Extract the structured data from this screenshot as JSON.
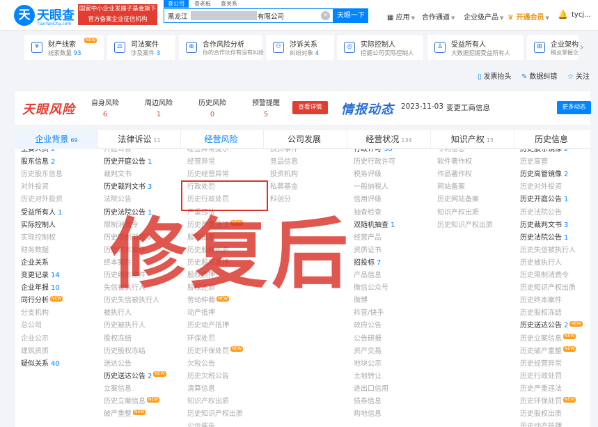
{
  "header": {
    "logo_mark": "天",
    "logo_name": "天眼查",
    "logo_domain": "TianYanCha.com",
    "slogan_line1": "国家中小企业发展子基金旗下",
    "slogan_line2": "官方备案企业征信机构",
    "search_tabs": [
      "查公司",
      "查老板",
      "查关系"
    ],
    "search_value_prefix": "黑龙江",
    "search_value_suffix": "有限公司",
    "search_button": "天眼一下",
    "nav": [
      {
        "label": "应用",
        "icon": "grid-icon"
      },
      {
        "label": "合作通道"
      },
      {
        "label": "企业级产品"
      },
      {
        "label": "开通会员",
        "icon": "crown-icon"
      }
    ],
    "user": "tycj..."
  },
  "cards": [
    {
      "title": "财产线索",
      "sub_prefix": "线索数量",
      "sub_value": "93",
      "badge": "NEW",
      "icon": "money-icon"
    },
    {
      "title": "司法案件",
      "sub_prefix": "涉及案件",
      "sub_value": "3",
      "icon": "gavel-icon"
    },
    {
      "title": "合作风险分析",
      "sub_prefix": "你的合作伙伴有没有纠纷",
      "sub_value": "",
      "icon": "handshake-icon"
    },
    {
      "title": "涉诉关系",
      "sub_prefix": "纠纷对象",
      "sub_value": "4",
      "icon": "people-icon"
    },
    {
      "title": "实际控制人",
      "sub_prefix": "挖掘公司实际控制人",
      "sub_value": "",
      "icon": "target-icon"
    },
    {
      "title": "受益所有人",
      "sub_prefix": "大数据挖掘受益所有人",
      "sub_value": "",
      "icon": "person-icon"
    },
    {
      "title": "企业架构",
      "sub_prefix": "稿总掌握企业",
      "sub_value": "",
      "icon": "org-icon"
    }
  ],
  "actions": [
    "发票抬头",
    "数据纠错",
    "关注"
  ],
  "risk": {
    "logo": "天眼风险",
    "items": [
      {
        "label": "自身风险",
        "value": "6"
      },
      {
        "label": "周边风险",
        "value": "1"
      },
      {
        "label": "历史风险",
        "value": "0"
      },
      {
        "label": "预警提醒",
        "value": "5"
      }
    ],
    "button": "查看详情"
  },
  "intel": {
    "logo": "情报动态",
    "date": "2023-11-03",
    "text": "变更工商信息",
    "button": "更多动态"
  },
  "tabs": [
    {
      "label": "企业背景",
      "count": "69"
    },
    {
      "label": "法律诉讼",
      "count": "11"
    },
    {
      "label": "经营风险",
      "count": ""
    },
    {
      "label": "公司发展",
      "count": ""
    },
    {
      "label": "经营状况",
      "count": "134"
    },
    {
      "label": "知识产权",
      "count": "15"
    },
    {
      "label": "历史信息",
      "count": ""
    }
  ],
  "columns": [
    [
      {
        "t": "主要人员",
        "n": "2"
      },
      {
        "t": "股东信息",
        "n": "2"
      },
      {
        "t": "历史股东信息",
        "d": true
      },
      {
        "t": "对外投资",
        "d": true
      },
      {
        "t": "历史对外投资",
        "d": true
      },
      {
        "t": "受益所有人",
        "n": "1"
      },
      {
        "t": "实际控制人"
      },
      {
        "t": "实际控制权",
        "d": true
      },
      {
        "t": "财务数据",
        "d": true
      },
      {
        "t": "企业关系"
      },
      {
        "t": "变更记录",
        "n": "14"
      },
      {
        "t": "企业年报",
        "n": "10"
      },
      {
        "t": "同行分析",
        "nw": "NEW"
      },
      {
        "t": "分支机构",
        "d": true
      },
      {
        "t": "总公司",
        "d": true
      },
      {
        "t": "企业公示",
        "d": true
      },
      {
        "t": "建筑资质",
        "d": true
      },
      {
        "t": "疑似关系",
        "n": "40"
      }
    ],
    [
      {
        "t": "开庭公告",
        "d": true
      },
      {
        "t": "历史开庭公告",
        "n": "1"
      },
      {
        "t": "裁判文书",
        "d": true
      },
      {
        "t": "历史裁判文书",
        "n": "3"
      },
      {
        "t": "法院公告",
        "d": true
      },
      {
        "t": "历史法院公告",
        "n": "1"
      },
      {
        "t": "限制消费令",
        "d": true
      },
      {
        "t": "历史限制消费令",
        "d": true
      },
      {
        "t": "历史终本案件",
        "d": true
      },
      {
        "t": "终本案件",
        "d": true
      },
      {
        "t": "历史终本案件",
        "d": true
      },
      {
        "t": "失信被执行人",
        "d": true
      },
      {
        "t": "历史失信被执行人",
        "d": true
      },
      {
        "t": "被执行人",
        "d": true
      },
      {
        "t": "历史被执行人",
        "d": true
      },
      {
        "t": "股权冻结",
        "d": true
      },
      {
        "t": "历史股权冻结",
        "d": true
      },
      {
        "t": "送达公告",
        "d": true
      },
      {
        "t": "历史送达公告",
        "n": "2",
        "nw": "NEW"
      },
      {
        "t": "立案信息",
        "d": true
      },
      {
        "t": "历史立案信息",
        "d": true,
        "nw": "NEW"
      },
      {
        "t": "破产重整",
        "d": true,
        "nw": "NEW"
      }
    ],
    [
      {
        "t": "经营异常提示",
        "d": true
      },
      {
        "t": "经营异常",
        "d": true
      },
      {
        "t": "历史经营异常",
        "d": true
      },
      {
        "t": "行政处罚",
        "d": true
      },
      {
        "t": "历史行政处罚",
        "d": true
      },
      {
        "t": "严重违法",
        "d": true
      },
      {
        "t": "历史严重违法",
        "d": true,
        "nw": "NEW"
      },
      {
        "t": "股权出质",
        "d": true
      },
      {
        "t": "历史股权出质",
        "d": true
      },
      {
        "t": "历史股权质押",
        "d": true
      },
      {
        "t": "股权质押",
        "d": true
      },
      {
        "t": "股权还原",
        "d": true
      },
      {
        "t": "劳动仲裁",
        "d": true,
        "nw": "NEW"
      },
      {
        "t": "动产抵押",
        "d": true
      },
      {
        "t": "历史动产抵押",
        "d": true
      },
      {
        "t": "环保处罚",
        "d": true
      },
      {
        "t": "历史环保处罚",
        "d": true,
        "nw": "NEW"
      },
      {
        "t": "欠税公告",
        "d": true
      },
      {
        "t": "历史欠税公告",
        "d": true
      },
      {
        "t": "清算信息",
        "d": true
      },
      {
        "t": "知识产权出质",
        "d": true
      },
      {
        "t": "历史知识产权出质",
        "d": true
      },
      {
        "t": "公示催告",
        "d": true
      }
    ],
    [
      {
        "t": "投资事件",
        "d": true
      },
      {
        "t": "竞品信息",
        "d": true
      },
      {
        "t": "投资机构",
        "d": true
      },
      {
        "t": "私募基金",
        "d": true
      },
      {
        "t": "科创分",
        "d": true
      }
    ],
    [
      {
        "t": "行政许可",
        "n": "30"
      },
      {
        "t": "历史行政许可",
        "d": true
      },
      {
        "t": "税务评级",
        "d": true
      },
      {
        "t": "一般纳税人",
        "d": true
      },
      {
        "t": "信用评级",
        "d": true
      },
      {
        "t": "抽查检查",
        "d": true
      },
      {
        "t": "双随机抽查",
        "n": "1"
      },
      {
        "t": "经营产品",
        "d": true
      },
      {
        "t": "资质证书",
        "d": true
      },
      {
        "t": "招投标",
        "n": "7"
      },
      {
        "t": "产品信息",
        "d": true
      },
      {
        "t": "微信公众号",
        "d": true
      },
      {
        "t": "微博",
        "d": true
      },
      {
        "t": "抖音/快手",
        "d": true
      },
      {
        "t": "政府公告",
        "d": true
      },
      {
        "t": "公告研报",
        "d": true
      },
      {
        "t": "资产交易",
        "d": true
      },
      {
        "t": "地块公示",
        "d": true
      },
      {
        "t": "土地转让",
        "d": true
      },
      {
        "t": "进出口信用",
        "d": true
      },
      {
        "t": "债券信息",
        "d": true
      },
      {
        "t": "购地信息",
        "d": true
      }
    ],
    [
      {
        "t": "专利信息",
        "d": true
      },
      {
        "t": "软件著作权",
        "d": true
      },
      {
        "t": "作品著作权",
        "d": true
      },
      {
        "t": "网站备案",
        "d": true
      },
      {
        "t": "历史网站备案",
        "d": true
      },
      {
        "t": "知识产权出质",
        "d": true
      },
      {
        "t": "历史知识产权出质",
        "d": true
      }
    ],
    [
      {
        "t": "历史股东镜像",
        "n": "2"
      },
      {
        "t": "历史高管",
        "d": true
      },
      {
        "t": "历史高管镜像",
        "n": "2"
      },
      {
        "t": "历史对外投资",
        "d": true
      },
      {
        "t": "历史开庭公告",
        "n": "1"
      },
      {
        "t": "历史法院公告",
        "d": true
      },
      {
        "t": "历史裁判文书",
        "n": "3"
      },
      {
        "t": "历史法院公告",
        "n": "1"
      },
      {
        "t": "历史失信被执行人",
        "d": true
      },
      {
        "t": "历史被执行人",
        "d": true
      },
      {
        "t": "历史限制消费令",
        "d": true
      },
      {
        "t": "历史知识产权出质",
        "d": true
      },
      {
        "t": "历史终本案件",
        "d": true
      },
      {
        "t": "历史股权冻结",
        "d": true
      },
      {
        "t": "历史送达公告",
        "n": "2",
        "nw": "NEW"
      },
      {
        "t": "历史立案信息",
        "d": true,
        "nw": "NEW"
      },
      {
        "t": "历史破产重整",
        "d": true,
        "nw": "NEW"
      },
      {
        "t": "历史经营异常",
        "d": true
      },
      {
        "t": "历史行政处罚",
        "d": true
      },
      {
        "t": "历史严重违法",
        "d": true
      },
      {
        "t": "历史环保处罚",
        "d": true,
        "nw": "NEW"
      },
      {
        "t": "历史股权出质",
        "d": true
      },
      {
        "t": "历史动产抵押",
        "d": true
      }
    ]
  ],
  "watermark": "修复后",
  "colors": {
    "brand_blue": "#0084ff",
    "risk_red": "#e23d31",
    "annotation_red": "#d9332a"
  }
}
